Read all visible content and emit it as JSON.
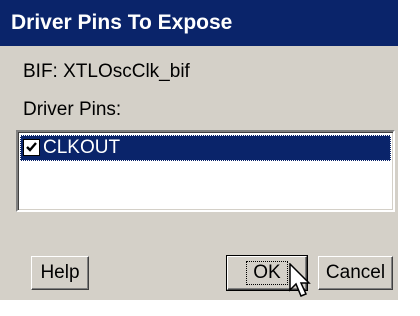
{
  "window": {
    "title": "Driver Pins To Expose"
  },
  "bif": {
    "text": "BIF:  XTLOscClk_bif"
  },
  "pins": {
    "label": "Driver Pins:",
    "items": [
      {
        "label": "CLKOUT",
        "checked": true,
        "selected": true
      }
    ]
  },
  "buttons": {
    "help": "Help",
    "ok": "OK",
    "cancel": "Cancel"
  },
  "icons": {
    "checkmark": "checkmark-icon",
    "cursor": "mouse-pointer-icon"
  },
  "colors": {
    "titlebar": "#0a246a",
    "face": "#d4d0c8",
    "selection": "#0a246a"
  }
}
